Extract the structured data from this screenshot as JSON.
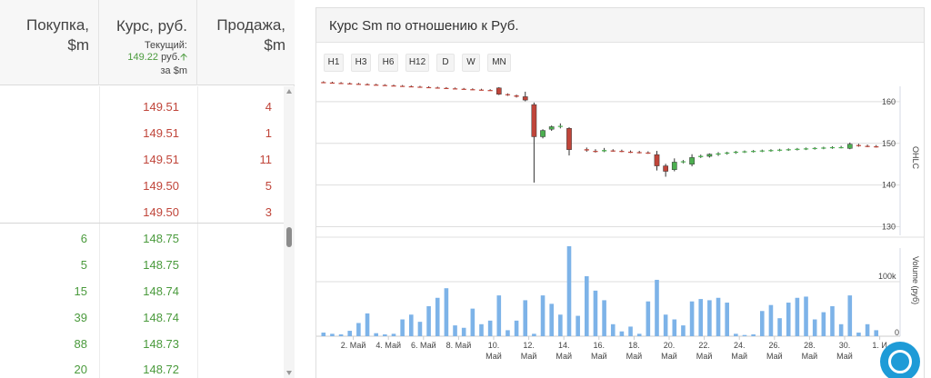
{
  "orderbook": {
    "headers": {
      "buy": [
        "Покупка,",
        "$m"
      ],
      "rate": "Курс, руб.",
      "rate_current_label": "Текущий:",
      "rate_current_value": "149.22",
      "rate_current_unit": "руб.",
      "rate_unit_note": "за $m",
      "sell": [
        "Продажа,",
        "$m"
      ]
    },
    "asks": [
      {
        "price": "149.51",
        "qty": "4"
      },
      {
        "price": "149.51",
        "qty": "1"
      },
      {
        "price": "149.51",
        "qty": "11"
      },
      {
        "price": "149.50",
        "qty": "5"
      },
      {
        "price": "149.50",
        "qty": "3"
      }
    ],
    "bids": [
      {
        "qty": "6",
        "price": "148.75"
      },
      {
        "qty": "5",
        "price": "148.75"
      },
      {
        "qty": "15",
        "price": "148.74"
      },
      {
        "qty": "39",
        "price": "148.74"
      },
      {
        "qty": "88",
        "price": "148.73"
      },
      {
        "qty": "20",
        "price": "148.72"
      }
    ],
    "colors": {
      "ask": "#c0453a",
      "bid": "#4a9a3c"
    }
  },
  "panel": {
    "title": "Курс Sm по отношению к Руб.",
    "timeframes": [
      "H1",
      "H3",
      "H6",
      "H12",
      "D",
      "W",
      "MN"
    ]
  },
  "chart_data": {
    "type": "candlestick",
    "price_axis": {
      "label": "OHLC",
      "ticks": [
        130,
        140,
        150,
        160
      ],
      "ylim": [
        127.5,
        165
      ]
    },
    "volume_axis": {
      "label": "Volume (руб)",
      "ticks": [
        "0",
        "100k"
      ],
      "ylim": [
        0,
        150000
      ]
    },
    "x_labels": [
      {
        "day": 2,
        "text": "2. Май"
      },
      {
        "day": 4,
        "text": "4. Май"
      },
      {
        "day": 6,
        "text": "6. Май"
      },
      {
        "day": 8,
        "text": "8. Май"
      },
      {
        "day": 10,
        "text": [
          "10.",
          "Май"
        ]
      },
      {
        "day": 12,
        "text": [
          "12.",
          "Май"
        ]
      },
      {
        "day": 14,
        "text": [
          "14.",
          "Май"
        ]
      },
      {
        "day": 16,
        "text": [
          "16.",
          "Май"
        ]
      },
      {
        "day": 18,
        "text": [
          "18.",
          "Май"
        ]
      },
      {
        "day": 20,
        "text": [
          "20.",
          "Май"
        ]
      },
      {
        "day": 22,
        "text": [
          "22.",
          "Май"
        ]
      },
      {
        "day": 24,
        "text": [
          "24.",
          "Май"
        ]
      },
      {
        "day": 26,
        "text": [
          "26.",
          "Май"
        ]
      },
      {
        "day": 28,
        "text": [
          "28.",
          "Май"
        ]
      },
      {
        "day": 30,
        "text": [
          "30.",
          "Май"
        ]
      },
      {
        "day": 32,
        "text": "1. И"
      }
    ],
    "candles": [
      {
        "day": 0.3,
        "o": 164.7,
        "h": 164.9,
        "l": 164.5,
        "c": 164.6
      },
      {
        "day": 0.8,
        "o": 164.6,
        "h": 164.8,
        "l": 164.4,
        "c": 164.5
      },
      {
        "day": 1.3,
        "o": 164.5,
        "h": 164.7,
        "l": 164.3,
        "c": 164.4
      },
      {
        "day": 1.8,
        "o": 164.4,
        "h": 164.6,
        "l": 164.2,
        "c": 164.3
      },
      {
        "day": 2.3,
        "o": 164.3,
        "h": 164.5,
        "l": 164.1,
        "c": 164.2
      },
      {
        "day": 2.8,
        "o": 164.2,
        "h": 164.4,
        "l": 164.0,
        "c": 164.1
      },
      {
        "day": 3.3,
        "o": 164.1,
        "h": 164.3,
        "l": 163.9,
        "c": 164.0
      },
      {
        "day": 3.8,
        "o": 164.0,
        "h": 164.2,
        "l": 163.8,
        "c": 163.9
      },
      {
        "day": 4.3,
        "o": 163.9,
        "h": 164.1,
        "l": 163.7,
        "c": 163.8
      },
      {
        "day": 4.8,
        "o": 163.8,
        "h": 164.0,
        "l": 163.6,
        "c": 163.7
      },
      {
        "day": 5.3,
        "o": 163.7,
        "h": 163.9,
        "l": 163.5,
        "c": 163.6
      },
      {
        "day": 5.8,
        "o": 163.6,
        "h": 163.8,
        "l": 163.4,
        "c": 163.5
      },
      {
        "day": 6.3,
        "o": 163.5,
        "h": 163.7,
        "l": 163.3,
        "c": 163.4
      },
      {
        "day": 6.8,
        "o": 163.4,
        "h": 163.6,
        "l": 163.2,
        "c": 163.3
      },
      {
        "day": 7.3,
        "o": 163.3,
        "h": 163.5,
        "l": 163.1,
        "c": 163.2
      },
      {
        "day": 7.8,
        "o": 163.2,
        "h": 163.4,
        "l": 163.0,
        "c": 163.1
      },
      {
        "day": 8.3,
        "o": 163.1,
        "h": 163.3,
        "l": 162.9,
        "c": 163.0
      },
      {
        "day": 8.8,
        "o": 163.0,
        "h": 163.2,
        "l": 162.8,
        "c": 162.9
      },
      {
        "day": 9.3,
        "o": 162.9,
        "h": 163.1,
        "l": 162.7,
        "c": 162.8
      },
      {
        "day": 9.8,
        "o": 162.8,
        "h": 163.0,
        "l": 162.6,
        "c": 162.7
      },
      {
        "day": 10.3,
        "o": 163.3,
        "h": 163.5,
        "l": 161.6,
        "c": 161.8
      },
      {
        "day": 10.8,
        "o": 161.8,
        "h": 162.0,
        "l": 161.4,
        "c": 161.6
      },
      {
        "day": 11.3,
        "o": 161.5,
        "h": 161.7,
        "l": 161.0,
        "c": 161.2
      },
      {
        "day": 11.8,
        "o": 161.2,
        "h": 162.4,
        "l": 160.1,
        "c": 160.4
      },
      {
        "day": 12.3,
        "o": 159.3,
        "h": 159.8,
        "l": 140.6,
        "c": 151.6
      },
      {
        "day": 12.8,
        "o": 151.6,
        "h": 153.4,
        "l": 151.2,
        "c": 153.1
      },
      {
        "day": 13.3,
        "o": 153.4,
        "h": 154.3,
        "l": 153.0,
        "c": 154.0
      },
      {
        "day": 13.8,
        "o": 154.1,
        "h": 154.8,
        "l": 153.6,
        "c": 154.2
      },
      {
        "day": 14.3,
        "o": 153.6,
        "h": 153.9,
        "l": 147.1,
        "c": 148.5
      },
      {
        "day": 15.3,
        "o": 148.6,
        "h": 149.0,
        "l": 148.0,
        "c": 148.3
      },
      {
        "day": 15.8,
        "o": 148.2,
        "h": 148.6,
        "l": 147.8,
        "c": 148.0
      },
      {
        "day": 16.3,
        "o": 148.1,
        "h": 148.9,
        "l": 147.9,
        "c": 148.4
      },
      {
        "day": 16.8,
        "o": 148.3,
        "h": 148.6,
        "l": 148.0,
        "c": 148.2
      },
      {
        "day": 17.3,
        "o": 148.2,
        "h": 148.5,
        "l": 147.9,
        "c": 148.1
      },
      {
        "day": 17.8,
        "o": 148.0,
        "h": 148.3,
        "l": 147.7,
        "c": 147.9
      },
      {
        "day": 18.3,
        "o": 147.9,
        "h": 148.2,
        "l": 147.6,
        "c": 147.8
      },
      {
        "day": 18.8,
        "o": 147.8,
        "h": 148.1,
        "l": 147.5,
        "c": 147.7
      },
      {
        "day": 19.3,
        "o": 147.3,
        "h": 148.2,
        "l": 143.5,
        "c": 144.6
      },
      {
        "day": 19.8,
        "o": 144.6,
        "h": 145.1,
        "l": 142.0,
        "c": 143.3
      },
      {
        "day": 20.3,
        "o": 143.7,
        "h": 146.4,
        "l": 143.3,
        "c": 145.5
      },
      {
        "day": 20.8,
        "o": 145.5,
        "h": 146.0,
        "l": 145.2,
        "c": 145.7
      },
      {
        "day": 21.3,
        "o": 145.0,
        "h": 147.4,
        "l": 144.5,
        "c": 146.6
      },
      {
        "day": 21.8,
        "o": 146.7,
        "h": 147.3,
        "l": 146.5,
        "c": 147.0
      },
      {
        "day": 22.3,
        "o": 146.9,
        "h": 147.6,
        "l": 146.6,
        "c": 147.4
      },
      {
        "day": 22.8,
        "o": 147.3,
        "h": 147.9,
        "l": 147.0,
        "c": 147.6
      },
      {
        "day": 23.3,
        "o": 147.6,
        "h": 148.0,
        "l": 147.3,
        "c": 147.8
      },
      {
        "day": 23.8,
        "o": 147.8,
        "h": 148.2,
        "l": 147.5,
        "c": 148.0
      },
      {
        "day": 24.3,
        "o": 148.0,
        "h": 148.3,
        "l": 147.7,
        "c": 148.1
      },
      {
        "day": 24.8,
        "o": 148.1,
        "h": 148.4,
        "l": 147.8,
        "c": 148.2
      },
      {
        "day": 25.3,
        "o": 148.2,
        "h": 148.5,
        "l": 147.9,
        "c": 148.3
      },
      {
        "day": 25.8,
        "o": 148.3,
        "h": 148.6,
        "l": 148.0,
        "c": 148.4
      },
      {
        "day": 26.3,
        "o": 148.4,
        "h": 148.7,
        "l": 148.1,
        "c": 148.5
      },
      {
        "day": 26.8,
        "o": 148.5,
        "h": 148.8,
        "l": 148.2,
        "c": 148.6
      },
      {
        "day": 27.3,
        "o": 148.6,
        "h": 148.9,
        "l": 148.3,
        "c": 148.7
      },
      {
        "day": 27.8,
        "o": 148.7,
        "h": 149.0,
        "l": 148.4,
        "c": 148.8
      },
      {
        "day": 28.3,
        "o": 148.8,
        "h": 149.1,
        "l": 148.5,
        "c": 148.9
      },
      {
        "day": 28.8,
        "o": 148.9,
        "h": 149.2,
        "l": 148.6,
        "c": 149.0
      },
      {
        "day": 29.3,
        "o": 149.0,
        "h": 149.3,
        "l": 148.7,
        "c": 149.1
      },
      {
        "day": 29.8,
        "o": 149.1,
        "h": 149.4,
        "l": 148.8,
        "c": 149.1
      },
      {
        "day": 30.3,
        "o": 148.8,
        "h": 150.2,
        "l": 148.6,
        "c": 149.8
      },
      {
        "day": 30.8,
        "o": 149.6,
        "h": 149.9,
        "l": 149.2,
        "c": 149.5
      },
      {
        "day": 31.3,
        "o": 149.4,
        "h": 149.7,
        "l": 149.1,
        "c": 149.3
      },
      {
        "day": 31.8,
        "o": 149.3,
        "h": 149.6,
        "l": 149.0,
        "c": 149.2
      }
    ],
    "volume": [
      {
        "day": 0.3,
        "v": 6000
      },
      {
        "day": 0.8,
        "v": 4000
      },
      {
        "day": 1.3,
        "v": 3000
      },
      {
        "day": 1.8,
        "v": 9000
      },
      {
        "day": 2.3,
        "v": 22000
      },
      {
        "day": 2.8,
        "v": 38000
      },
      {
        "day": 3.3,
        "v": 5000
      },
      {
        "day": 3.8,
        "v": 3000
      },
      {
        "day": 4.3,
        "v": 4000
      },
      {
        "day": 4.8,
        "v": 28000
      },
      {
        "day": 5.3,
        "v": 36000
      },
      {
        "day": 5.8,
        "v": 24000
      },
      {
        "day": 6.3,
        "v": 50000
      },
      {
        "day": 6.8,
        "v": 64000
      },
      {
        "day": 7.3,
        "v": 80000
      },
      {
        "day": 7.8,
        "v": 18000
      },
      {
        "day": 8.3,
        "v": 14000
      },
      {
        "day": 8.8,
        "v": 46000
      },
      {
        "day": 9.3,
        "v": 20000
      },
      {
        "day": 9.8,
        "v": 26000
      },
      {
        "day": 10.3,
        "v": 68000
      },
      {
        "day": 10.8,
        "v": 10000
      },
      {
        "day": 11.3,
        "v": 26000
      },
      {
        "day": 11.8,
        "v": 60000
      },
      {
        "day": 12.3,
        "v": 4000
      },
      {
        "day": 12.8,
        "v": 68000
      },
      {
        "day": 13.3,
        "v": 54000
      },
      {
        "day": 13.8,
        "v": 36000
      },
      {
        "day": 14.3,
        "v": 150000
      },
      {
        "day": 14.8,
        "v": 34000
      },
      {
        "day": 15.3,
        "v": 100000
      },
      {
        "day": 15.8,
        "v": 76000
      },
      {
        "day": 16.3,
        "v": 60000
      },
      {
        "day": 16.8,
        "v": 20000
      },
      {
        "day": 17.3,
        "v": 8000
      },
      {
        "day": 17.8,
        "v": 16000
      },
      {
        "day": 18.3,
        "v": 4000
      },
      {
        "day": 18.8,
        "v": 58000
      },
      {
        "day": 19.3,
        "v": 94000
      },
      {
        "day": 19.8,
        "v": 36000
      },
      {
        "day": 20.3,
        "v": 28000
      },
      {
        "day": 20.8,
        "v": 18000
      },
      {
        "day": 21.3,
        "v": 58000
      },
      {
        "day": 21.8,
        "v": 62000
      },
      {
        "day": 22.3,
        "v": 60000
      },
      {
        "day": 22.8,
        "v": 64000
      },
      {
        "day": 23.3,
        "v": 56000
      },
      {
        "day": 23.8,
        "v": 4000
      },
      {
        "day": 24.3,
        "v": 2000
      },
      {
        "day": 24.8,
        "v": 3000
      },
      {
        "day": 25.3,
        "v": 42000
      },
      {
        "day": 25.8,
        "v": 52000
      },
      {
        "day": 26.3,
        "v": 30000
      },
      {
        "day": 26.8,
        "v": 56000
      },
      {
        "day": 27.3,
        "v": 64000
      },
      {
        "day": 27.8,
        "v": 66000
      },
      {
        "day": 28.3,
        "v": 28000
      },
      {
        "day": 28.8,
        "v": 40000
      },
      {
        "day": 29.3,
        "v": 50000
      },
      {
        "day": 29.8,
        "v": 20000
      },
      {
        "day": 30.3,
        "v": 68000
      },
      {
        "day": 30.8,
        "v": 6000
      },
      {
        "day": 31.3,
        "v": 20000
      },
      {
        "day": 31.8,
        "v": 10000
      }
    ],
    "colors": {
      "up": "#4caf50",
      "down": "#c0453a",
      "volume": "#7db3e8",
      "grid": "#dedede"
    },
    "grid": true
  }
}
